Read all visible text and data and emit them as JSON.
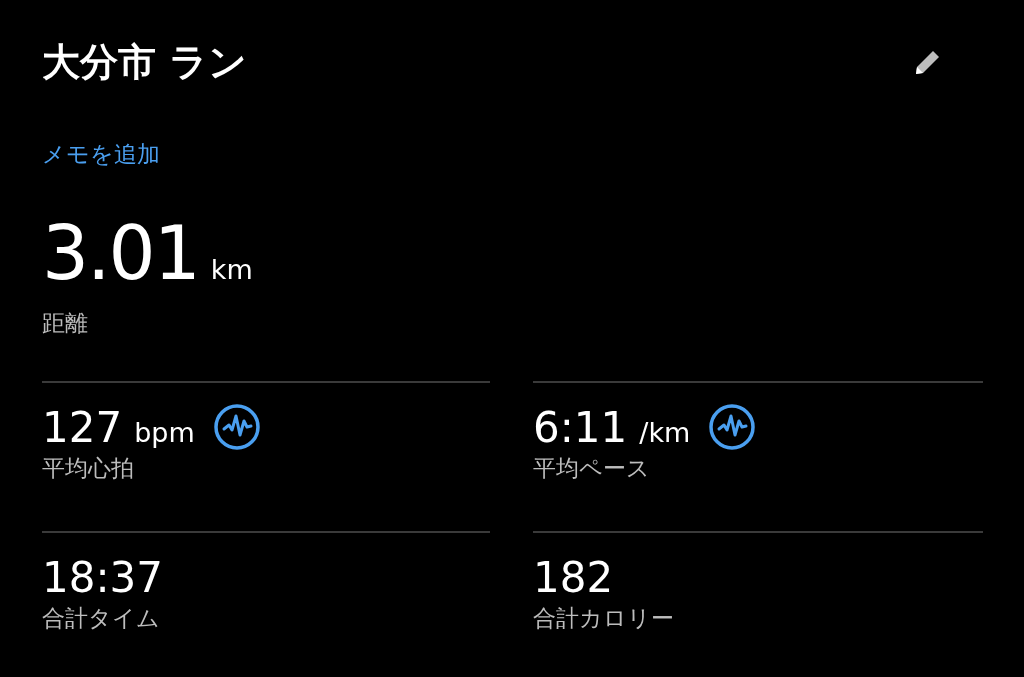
{
  "title": "大分市 ラン",
  "memo_link": "メモを追加",
  "distance": {
    "value": "3.01",
    "unit": "km",
    "label": "距離"
  },
  "stats": [
    {
      "value": "127",
      "unit": "bpm",
      "label": "平均心拍",
      "icon": true
    },
    {
      "value": "6:11",
      "unit": "/km",
      "label": "平均ペース",
      "icon": true
    },
    {
      "value": "18:37",
      "label": "合計タイム",
      "icon": false
    },
    {
      "value": "182",
      "label": "合計カロリー",
      "icon": false
    }
  ]
}
